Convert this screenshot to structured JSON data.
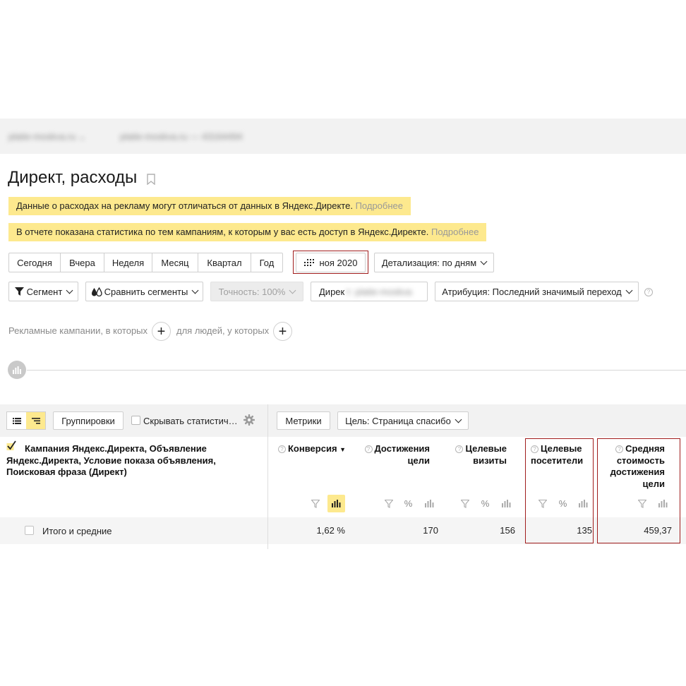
{
  "header": {
    "site_name": "platie-moskva.ru",
    "counter_label": "platie-moskva.ru — 43164494"
  },
  "page": {
    "title": "Директ, расходы"
  },
  "notices": [
    {
      "text": "Данные о расходах на рекламу могут отличаться от данных в Яндекс.Директе. ",
      "link": "Подробнее"
    },
    {
      "text": "В отчете показана статистика по тем кампаниям, к которым у вас есть доступ в Яндекс.Директе. ",
      "link": "Подробнее"
    }
  ],
  "period": {
    "buttons": [
      "Сегодня",
      "Вчера",
      "Неделя",
      "Месяц",
      "Квартал",
      "Год"
    ],
    "date_label": "ноя 2020",
    "detail_label": "Детализация: по дням"
  },
  "filters": {
    "segment": "Сегмент",
    "compare": "Сравнить сегменты",
    "accuracy": "Точность: 100%",
    "direct_prefix": "Дирек",
    "direct_blurred": "т: platie-moskva",
    "attribution": "Атрибуция: Последний значимый переход"
  },
  "segment_builder": {
    "campaigns_text": "Рекламные кампании, в которых",
    "people_text": "для людей, у которых"
  },
  "table_toolbar": {
    "groupings": "Группировки",
    "hide_stats": "Скрывать статистич…",
    "metrics": "Метрики",
    "goal": "Цель: Страница спасибо"
  },
  "table": {
    "dimension_header": "Кампания Яндекс.Директа, Объявление Яндекс.Директа, Условие показа объявления, Поисковая фраза (Директ)",
    "columns": [
      {
        "label": "Конверсия",
        "sort_arrow": "▼"
      },
      {
        "label": "Достижения цели"
      },
      {
        "label": "Целевые визиты"
      },
      {
        "label": "Целевые посетители"
      },
      {
        "label": "Средняя стоимость достижения цели"
      }
    ],
    "total": {
      "label": "Итого и средние",
      "values": [
        "1,62 %",
        "170",
        "156",
        "135",
        "459,37"
      ]
    }
  },
  "colors": {
    "notice_bg": "#fde98e",
    "highlight_border": "#a01c1c",
    "link_muted": "#999999"
  }
}
